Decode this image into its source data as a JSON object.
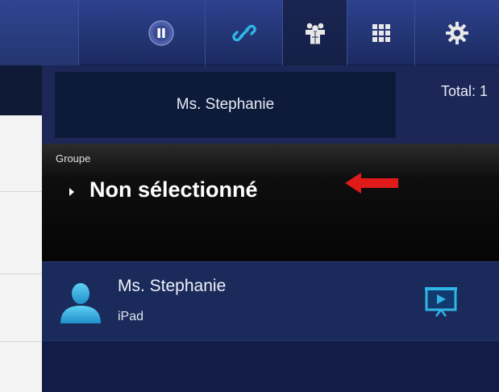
{
  "toolbar": {
    "buttons": [
      {
        "icon": "pause-icon"
      },
      {
        "icon": "link-icon"
      },
      {
        "icon": "group-icon",
        "active": true
      },
      {
        "icon": "grid-icon"
      },
      {
        "icon": "gear-icon"
      }
    ]
  },
  "panel": {
    "teacher_name": "Ms. Stephanie",
    "total_label": "Total: 1",
    "group": {
      "label": "Groupe",
      "value": "Non sélectionné"
    },
    "students": [
      {
        "name": "Ms. Stephanie",
        "device": "iPad"
      }
    ]
  },
  "colors": {
    "toolbar_bg": "#2d418f",
    "panel_bg": "#151c4a",
    "accent_cyan": "#2fb6e6",
    "arrow_red": "#e01919"
  }
}
